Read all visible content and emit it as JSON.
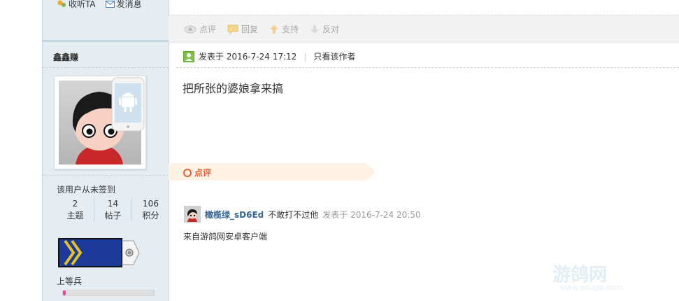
{
  "sidebar": {
    "listen_label": "收听TA",
    "message_label": "发消息",
    "username": "鑫鑫赚",
    "signin_status": "该用户从未签到",
    "stats": [
      {
        "value": "2",
        "label": "主题"
      },
      {
        "value": "14",
        "label": "帖子"
      },
      {
        "value": "106",
        "label": "积分"
      }
    ],
    "rank": "上等兵",
    "rank_progress_pct": 3
  },
  "post_actions": {
    "comment": "点评",
    "reply": "回复",
    "support": "支持",
    "oppose": "反对"
  },
  "post": {
    "posted_at": "发表于 2016-7-24 17:12",
    "author_only": "只看该作者",
    "content": "把所张的婆娘拿来搞"
  },
  "review": {
    "label": "点评",
    "comments": [
      {
        "author": "橄榄绿_sD6Ed",
        "text": "不敢打不过他",
        "time": "发表于 2016-7-24 20:50"
      }
    ]
  },
  "post_footer": "来自游鸽网安卓客户端",
  "watermark": {
    "logo": "游鸽网",
    "url": "www.youge.com"
  },
  "colors": {
    "accent": "#336699",
    "review": "#e95f35",
    "sidebar_bg": "#e5edf2"
  }
}
